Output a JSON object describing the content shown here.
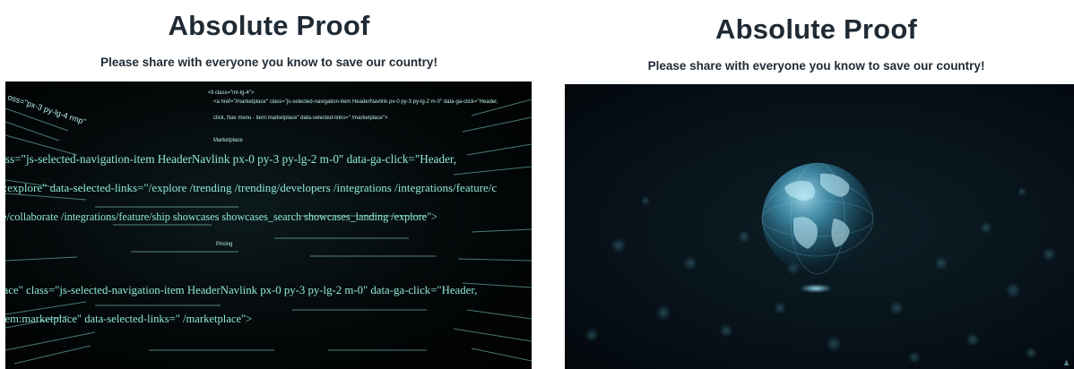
{
  "left": {
    "title": "Absolute Proof",
    "subtitle": "Please share with everyone you know to save our country!",
    "video": {
      "description_icon": "code-matrix-video",
      "code_lines": [
        "ass=\"js-selected-navigation-item HeaderNavlink px-0 py-3 py-lg-2 m-0\" data-ga-click=\"Header,",
        "n:explore\" data-selected-links=\"/explore /trending /trending/developers /integrations /integrations/feature/c",
        "re/collaborate /integrations/feature/ship showcases showcases_search showcases_landing /explore\">",
        "lace\" class=\"js-selected-navigation-item HeaderNavlink px-0 py-3 py-lg-2 m-0\" data-ga-click=\"Header,",
        "tem:marketplace\" data-selected-links=\" /marketplace\">"
      ],
      "small_lines": [
        "<li class=\"mt-lg-4\">",
        "<a href=\"/marketplace\" class=\"js-selected-navigation-item HeaderNavlink px-0 py-3 py-lg-2 m-0\" data-ga-click=\"Header,",
        "click, Nav menu - item:marketplace\" data-selected-links=\" /marketplace\">",
        "Marketplace",
        "Pricing"
      ]
    }
  },
  "right": {
    "title": "Absolute Proof",
    "subtitle": "Please share with everyone you know to save our country!",
    "video": {
      "description_icon": "digital-globe-video"
    }
  },
  "colors": {
    "text": "#1f2a34",
    "code_glow": "#8fe8da",
    "globe": "#5fb8d6"
  }
}
